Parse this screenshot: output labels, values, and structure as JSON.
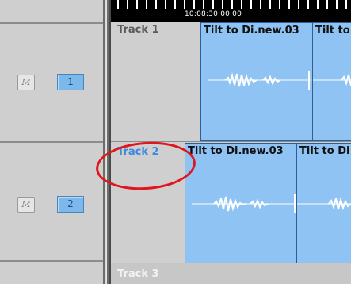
{
  "ruler": {
    "timecode": "10:08:30:00.00"
  },
  "tracks": [
    {
      "name": "Track 1",
      "mute_label": "M",
      "number": "1"
    },
    {
      "name": "Track 2",
      "mute_label": "M",
      "number": "2"
    },
    {
      "name": "Track 3"
    }
  ],
  "clips": {
    "track1": [
      "Tilt to Di.new.03",
      "Tilt to"
    ],
    "track2": [
      "Tilt to Di.new.03",
      "Tilt to Di"
    ]
  },
  "colors": {
    "clip": "#8fc3f3",
    "active_track": "#3a8be0",
    "annotation": "#e0151d"
  },
  "annotation": {
    "shape": "ellipse"
  }
}
